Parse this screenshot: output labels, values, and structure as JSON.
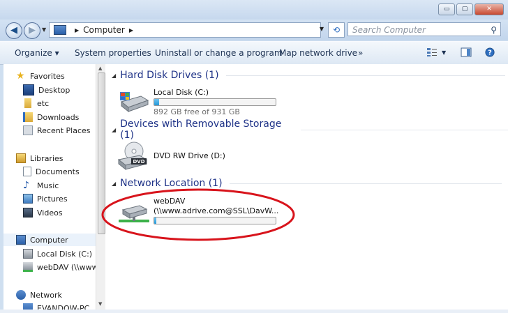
{
  "window": {
    "controls": [
      {
        "name": "minimize-button",
        "glyph": "▭"
      },
      {
        "name": "maximize-button",
        "glyph": "▢"
      },
      {
        "name": "close-button",
        "glyph": "✕"
      }
    ]
  },
  "address": {
    "path": [
      "Computer"
    ],
    "search_placeholder": "Search Computer"
  },
  "toolbar": {
    "organize": "Organize ▾",
    "system_properties": "System properties",
    "uninstall": "Uninstall or change a program",
    "map_network": "Map network drive",
    "more": "»"
  },
  "sidebar": {
    "favorites": {
      "label": "Favorites",
      "items": [
        "Desktop",
        "etc",
        "Downloads",
        "Recent Places"
      ]
    },
    "libraries": {
      "label": "Libraries",
      "items": [
        "Documents",
        "Music",
        "Pictures",
        "Videos"
      ]
    },
    "computer": {
      "label": "Computer",
      "items": [
        "Local Disk (C:)",
        "webDAV (\\\\www"
      ]
    },
    "network": {
      "label": "Network",
      "items": [
        "EVANDOW-PC"
      ]
    }
  },
  "groups": {
    "hdd": {
      "title": "Hard Disk Drives (1)",
      "items": [
        {
          "name": "Local Disk (C:)",
          "free": "892 GB free of 931 GB",
          "used_fraction": 0.04
        }
      ]
    },
    "removable": {
      "title": "Devices with Removable Storage (1)",
      "items": [
        {
          "name": "DVD RW Drive (D:)"
        }
      ]
    },
    "network": {
      "title": "Network Location (1)",
      "items": [
        {
          "name": "webDAV",
          "sub": "(\\\\www.adrive.com@SSL\\DavW...",
          "used_fraction": 0.02
        }
      ]
    }
  },
  "colors": {
    "group_title": "#1e3287",
    "highlight_oval": "#d8141c",
    "bar_fill": "#259ad9"
  }
}
